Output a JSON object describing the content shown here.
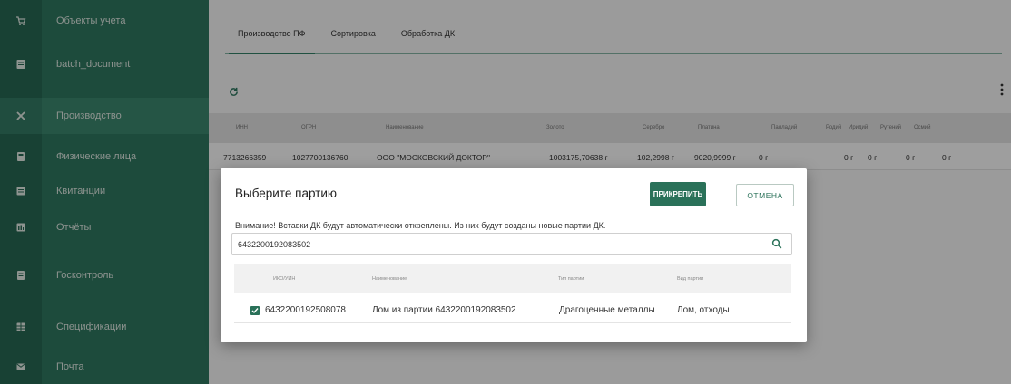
{
  "sidebar": {
    "items": [
      {
        "label": "Объекты учета",
        "icon": "cart-icon",
        "glyph": "🛒"
      },
      {
        "label": "batch_document",
        "icon": "document-icon",
        "glyph": "▤"
      },
      {
        "label": "Производство",
        "icon": "tools-icon",
        "glyph": "✖"
      },
      {
        "label": "Физические лица",
        "icon": "id-card-icon",
        "glyph": "▣"
      },
      {
        "label": "Квитанции",
        "icon": "receipt-icon",
        "glyph": "▤"
      },
      {
        "label": "Отчёты",
        "icon": "report-icon",
        "glyph": "▣"
      },
      {
        "label": "Госконтроль",
        "icon": "control-icon",
        "glyph": "▤"
      },
      {
        "label": "Спецификации",
        "icon": "table-icon",
        "glyph": "▦"
      },
      {
        "label": "Почта",
        "icon": "mail-icon",
        "glyph": "✉"
      }
    ]
  },
  "main": {
    "tabs": [
      "Производство ПФ",
      "Сортировка",
      "Обработка ДК"
    ],
    "table": {
      "headers": [
        "ИНН",
        "ОГРН",
        "Наименование",
        "Золото",
        "Серебро",
        "Платина",
        "Палладий",
        "Родий",
        "Иридий",
        "Рутений",
        "Осмий"
      ],
      "row": [
        "7713266359",
        "1027700136760",
        "ООО \"МОСКОВСКИЙ ДОКТОР\"",
        "1003175,70638 г",
        "102,2998 г",
        "9020,9999 г",
        "0 г",
        "0 г",
        "0 г",
        "0 г",
        "0 г"
      ]
    }
  },
  "modal": {
    "title": "Выберите партию",
    "attach_label": "ПРИКРЕПИТЬ",
    "cancel_label": "ОТМЕНА",
    "warning": "Внимание! Вставки ДК будут автоматически откреплены. Из них будут созданы новые партии ДК.",
    "search_value": "6432200192083502",
    "search_icon": "search-icon",
    "headers": [
      "ИКО/УИН",
      "Наименование",
      "Тип партии",
      "Вид партии"
    ],
    "rows": [
      {
        "checked": true,
        "id": "6432200192508078",
        "name": "Лом из партии 6432200192083502",
        "type": "Драгоценные металлы",
        "kind": "Лом, отходы"
      }
    ]
  },
  "colors": {
    "sidebar": "#2f7a62",
    "accent": "#2a7159"
  }
}
